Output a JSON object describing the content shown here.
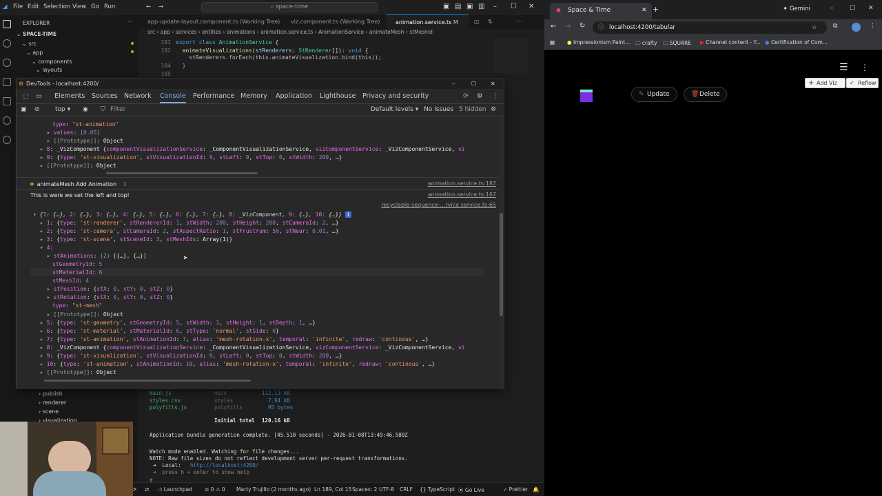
{
  "vscode": {
    "menu": [
      "File",
      "Edit",
      "Selection",
      "View",
      "Go",
      "Run"
    ],
    "search": "space-time",
    "explorer_title": "EXPLORER",
    "project": "SPACE-TIME",
    "tree": [
      "src",
      "app",
      "components",
      "layouts"
    ],
    "tabs": [
      "app-update-layout.component.ts (Working Tree)",
      "viz.component.ts (Working Tree)",
      "animation.service.ts"
    ],
    "tab_badge": "M",
    "breadcrumb": "src › app › services › entities › animations › animation.service.ts › AnimationService › animateMesh › stMeshId",
    "code": [
      {
        "ln": "181",
        "text": "export class AnimationService {"
      },
      {
        "ln": "182",
        "text": "  animateVisualizations(stRenderers: StRenderer[]): void {"
      },
      {
        "ln": "",
        "text": "    stRenderers.forEach(this.animateVisualization.bind(this));"
      },
      {
        "ln": "184",
        "text": "  }"
      },
      {
        "ln": "185",
        "text": ""
      }
    ],
    "sidebar_items": [
      "publish",
      "renderer",
      "scene",
      "visualization"
    ],
    "terminal": [
      {
        "a": "main.js",
        "b": "main",
        "c": "112.13 kB"
      },
      {
        "a": "styles.css",
        "b": "styles",
        "c": "7.94 kB"
      },
      {
        "a": "polyfills.js",
        "b": "polyfills",
        "c": "95 bytes"
      }
    ],
    "initial_total_label": "Initial total",
    "initial_total": "120.16 kB",
    "bundle_msg": "Application bundle generation complete. [45.510 seconds] - 2026-01-08T13:49:46.580Z",
    "watch_msg": "Watch mode enabled. Watching for file changes...",
    "note_msg": "NOTE: Raw file sizes do not reflect development server per-request transformations.",
    "local_label": "➜  Local:",
    "local_url": "http://localhost:4200/",
    "help_msg": "➜  press h + enter to show help",
    "status": [
      "Launchpad",
      "⊘ 0 ⚠ 0",
      "Marty Trujillo (2 months ago)",
      "Ln 189, Col 15",
      "Spaces: 2",
      "UTF-8",
      "CRLF",
      "{} TypeScript",
      "Go Live",
      "Prettier"
    ]
  },
  "devtools": {
    "title": "DevTools - localhost:4200/",
    "tabs": [
      "Elements",
      "Sources",
      "Network",
      "Console",
      "Performance",
      "Memory",
      "Application",
      "Lighthouse",
      "Privacy and security"
    ],
    "active_tab": "Console",
    "context": "top",
    "filter_placeholder": "Filter",
    "levels": "Default levels ▾",
    "issues": "No Issues",
    "hidden": "5 hidden",
    "log_group_label": "animateMesh Add Animation",
    "log_group_count": "1",
    "src1": "animation.service.ts:187",
    "log_msg": "This is were we set the left and top!",
    "src2": "animation.service.ts:167",
    "src3": "recyclable-sequence-…rvice.service.ts:65"
  },
  "chrome": {
    "tab_title": "Space & Time",
    "gemini": "Gemini",
    "url": "localhost:4200/tabular",
    "bookmarks": [
      "Impressionism Paint...",
      "crafty",
      "SQUARE",
      "Channel content - Y...",
      "Certification of Com..."
    ],
    "update": "Update",
    "delete": "Delete",
    "add_viz": "Add Viz",
    "reflow": "Reflow",
    "accent_update": "#2ea043",
    "accent_delete": "#e5534b",
    "cube_color": "#7b2fe0"
  }
}
